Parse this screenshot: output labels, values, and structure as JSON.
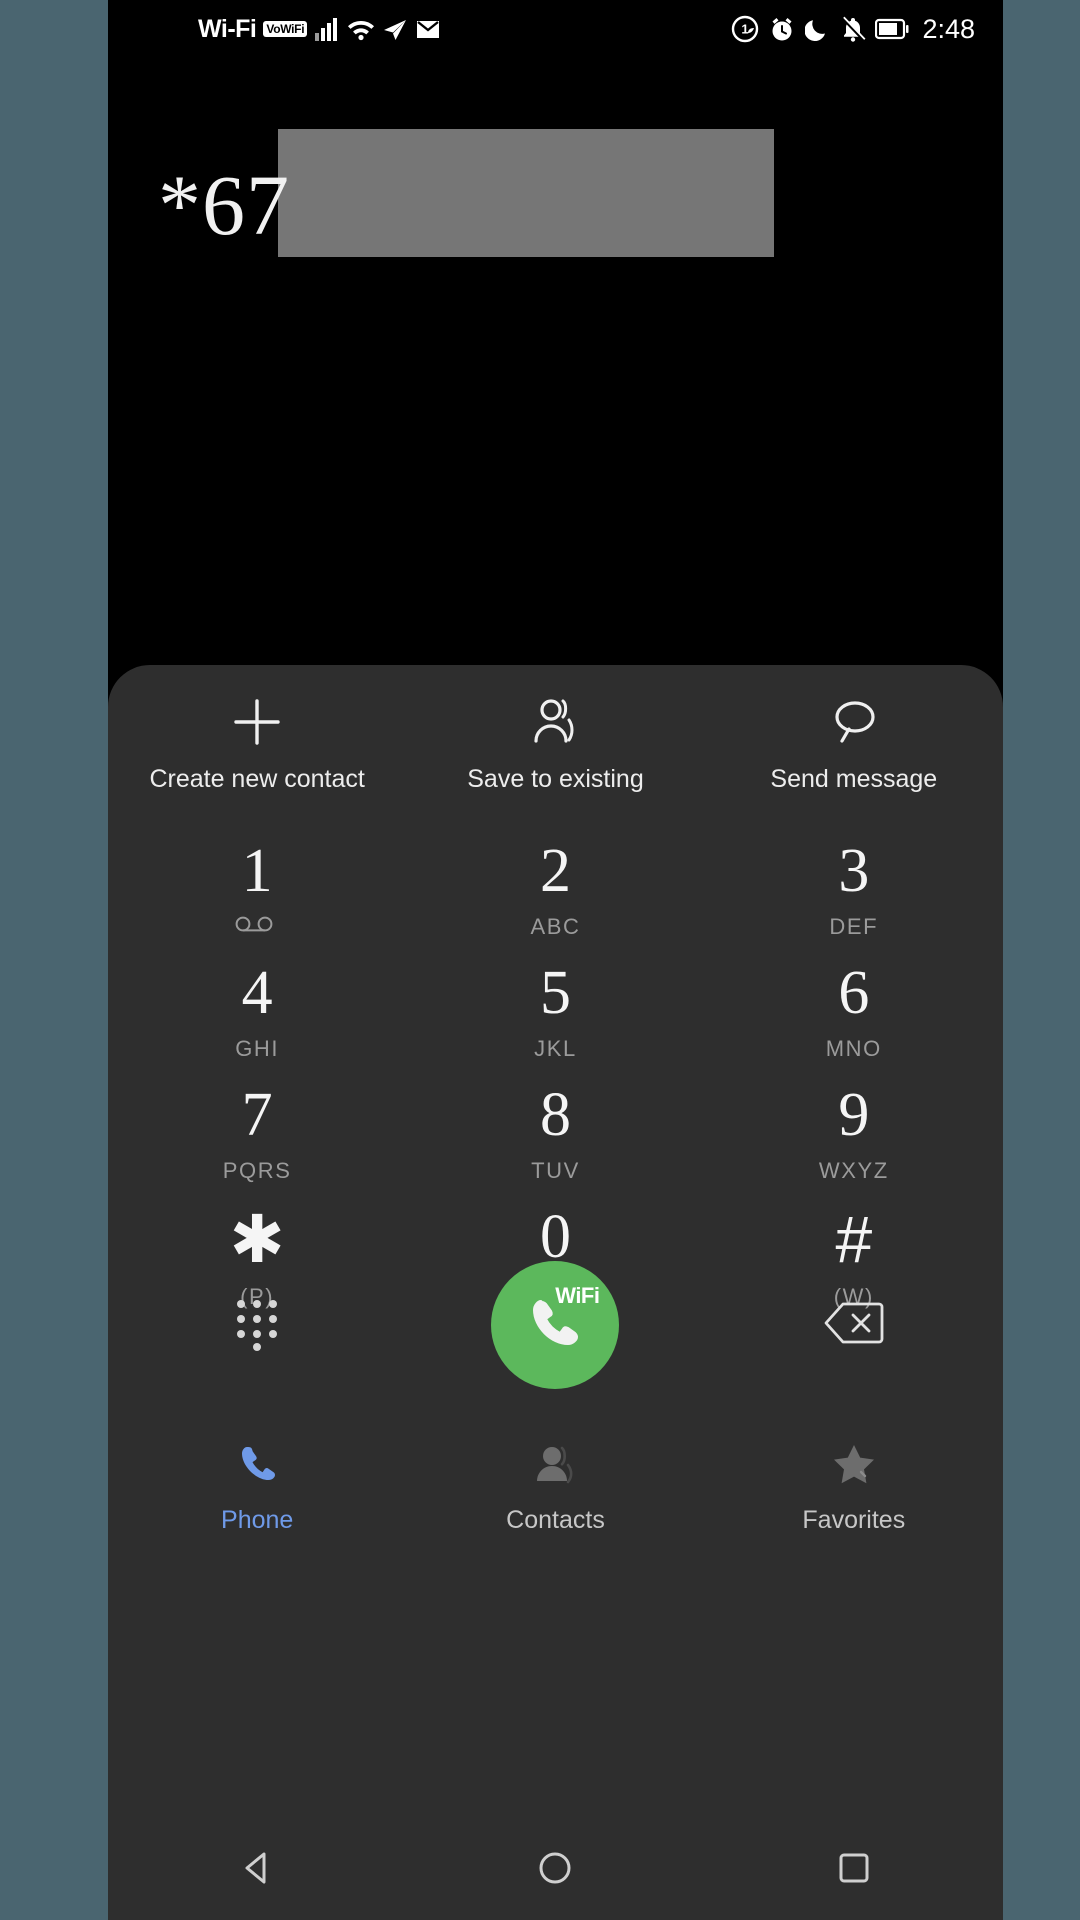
{
  "status_bar": {
    "wifi_label": "Wi-Fi",
    "vowifi_badge": "VoWiFi",
    "time": "2:48",
    "icons": [
      "signal-bars-icon",
      "wifi-icon",
      "location-icon",
      "mail-icon",
      "data-saver-icon",
      "alarm-icon",
      "do-not-disturb-moon-icon",
      "mute-bell-icon",
      "battery-icon"
    ]
  },
  "number_display": {
    "dialed_number": "*67",
    "redacted": true
  },
  "actions": [
    {
      "label": "Create new contact",
      "icon": "plus-icon"
    },
    {
      "label": "Save to existing",
      "icon": "person-add-icon"
    },
    {
      "label": "Send message",
      "icon": "message-bubble-icon"
    }
  ],
  "keypad": [
    [
      {
        "digit": "1",
        "sub": "",
        "icon": "voicemail-icon"
      },
      {
        "digit": "2",
        "sub": "ABC",
        "icon": ""
      },
      {
        "digit": "3",
        "sub": "DEF",
        "icon": ""
      }
    ],
    [
      {
        "digit": "4",
        "sub": "GHI",
        "icon": ""
      },
      {
        "digit": "5",
        "sub": "JKL",
        "icon": ""
      },
      {
        "digit": "6",
        "sub": "MNO",
        "icon": ""
      }
    ],
    [
      {
        "digit": "7",
        "sub": "PQRS",
        "icon": ""
      },
      {
        "digit": "8",
        "sub": "TUV",
        "icon": ""
      },
      {
        "digit": "9",
        "sub": "WXYZ",
        "icon": ""
      }
    ],
    [
      {
        "digit": "✱",
        "sub": "(P)",
        "icon": ""
      },
      {
        "digit": "0",
        "sub": "+",
        "icon": ""
      },
      {
        "digit": "#",
        "sub": "(W)",
        "icon": ""
      }
    ]
  ],
  "call_row": {
    "keypad_toggle_icon": "dialpad-icon",
    "call_button": {
      "icon": "phone-handset-icon",
      "badge": "WiFi",
      "color": "#5cb85c"
    },
    "delete_icon": "backspace-icon"
  },
  "tabs": [
    {
      "label": "Phone",
      "icon": "phone-icon",
      "active": true
    },
    {
      "label": "Contacts",
      "icon": "person-icon",
      "active": false
    },
    {
      "label": "Favorites",
      "icon": "star-icon",
      "active": false
    }
  ],
  "nav_bar": [
    {
      "icon": "back-triangle-icon"
    },
    {
      "icon": "home-circle-icon"
    },
    {
      "icon": "recents-square-icon"
    }
  ],
  "colors": {
    "background": "#4a6570",
    "screen": "#000000",
    "panel": "#2e2e2e",
    "accent_blue": "#6f9ae8",
    "call_green": "#5cb85c",
    "redaction_gray": "#767676"
  }
}
